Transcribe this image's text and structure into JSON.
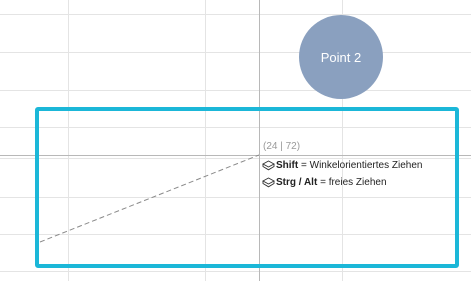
{
  "canvas": {
    "grid_color": "#e4e4e4",
    "guide_color": "#b8b8b8",
    "selection_color": "#1bb7d8"
  },
  "node": {
    "label": "Point 2",
    "fill_color": "#8aa0bf",
    "text_color": "#ffffff"
  },
  "drag": {
    "coordinates": "(24 | 72)",
    "line_style": "dashed",
    "hints": [
      {
        "icon": "keyboard-modifier-icon",
        "key": "Shift",
        "separator": " = ",
        "action": "Winkelorientiertes Ziehen"
      },
      {
        "icon": "keyboard-modifier-icon",
        "key": "Strg / Alt",
        "separator": " = ",
        "action": "freies Ziehen"
      }
    ]
  }
}
